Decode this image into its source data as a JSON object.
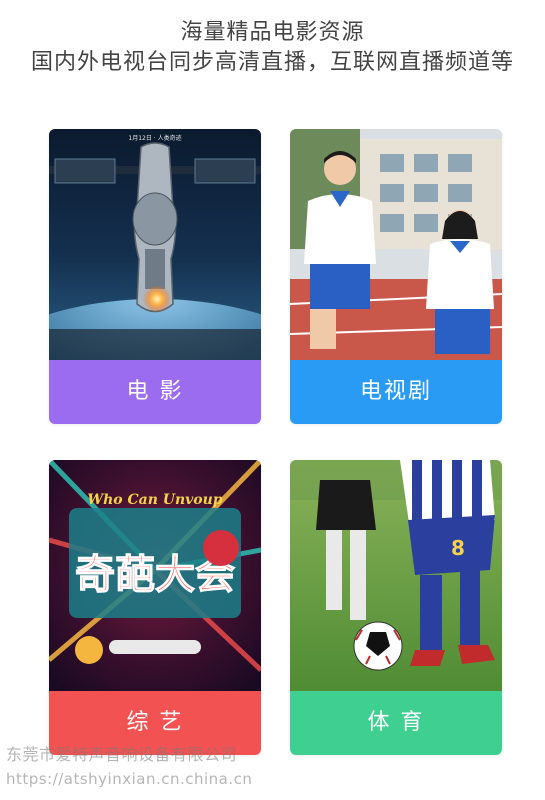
{
  "header": {
    "line1": "海量精品电影资源",
    "line2": "国内外电视台同步高清直播，互联网直播频道等"
  },
  "cards": [
    {
      "label": "电 影",
      "poster_text": "1月12日 · 人类奇迹",
      "image": "space-station-poster",
      "color": "#9b6cf0"
    },
    {
      "label": "电视剧",
      "image": "students-running-photo",
      "color": "#2a9bf5"
    },
    {
      "label": "综 艺",
      "poster_text": "Who Can Unvoup",
      "logo_text": "奇葩大会",
      "image": "variety-show-poster",
      "color": "#f25252"
    },
    {
      "label": "体 育",
      "image": "soccer-player-photo",
      "jersey_number": "8",
      "color": "#3fcf91"
    }
  ],
  "watermark": {
    "company": "东莞市爱特声音响设备有限公司",
    "url": "https://atshyinxian.cn.china.cn"
  }
}
